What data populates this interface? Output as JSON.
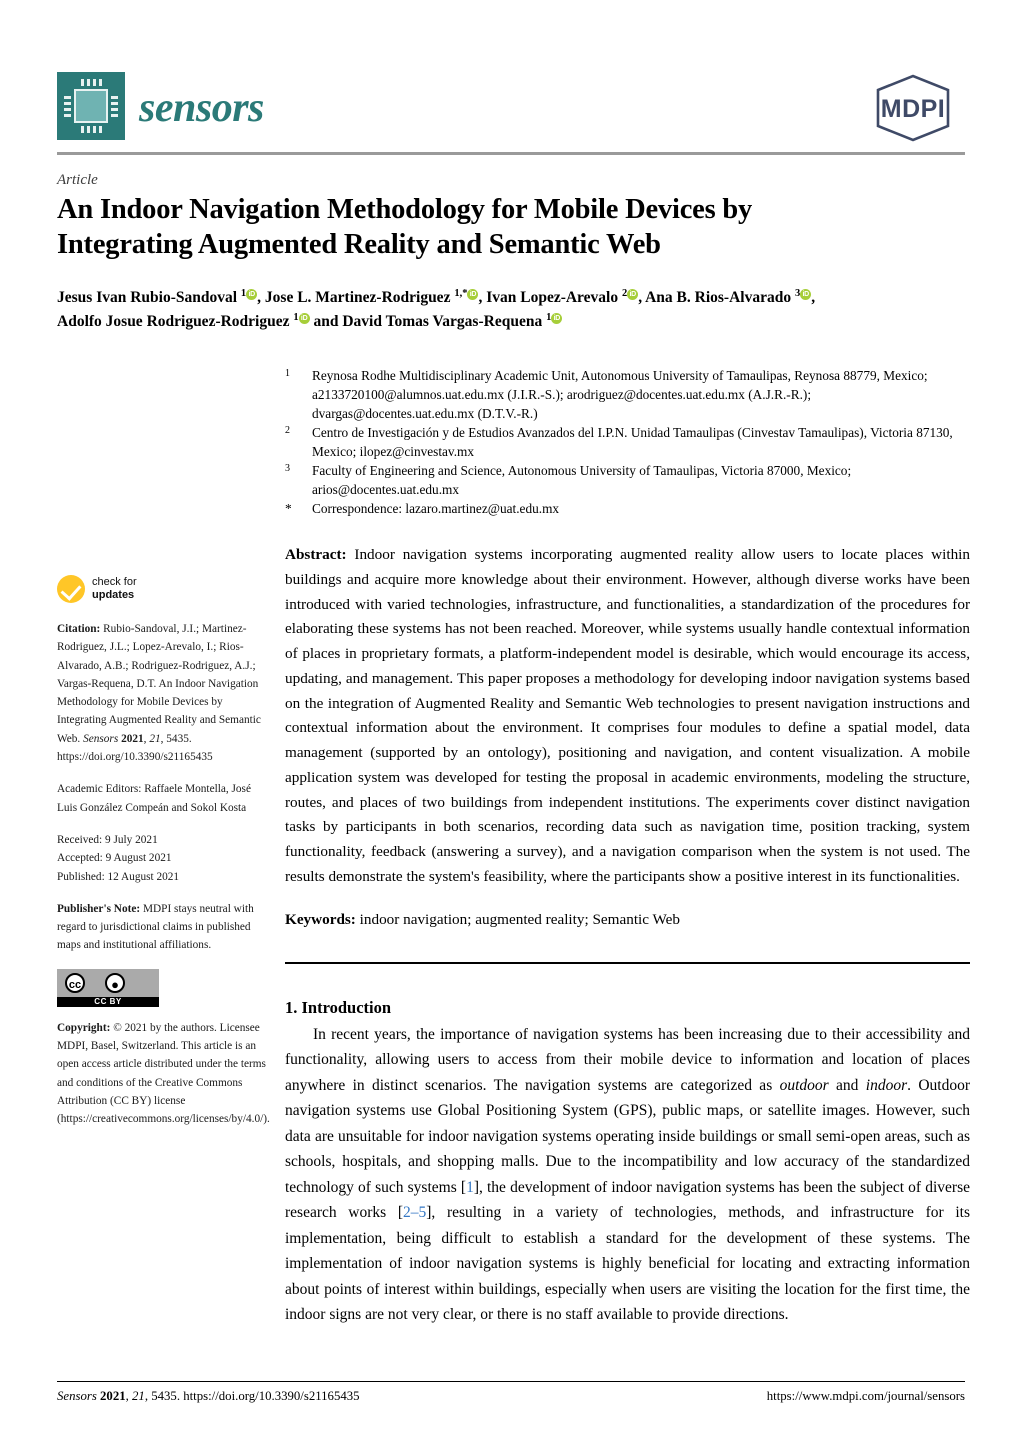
{
  "header": {
    "journal_name": "sensors",
    "publisher_logo": "MDPI",
    "logo_icon": "microchip-icon"
  },
  "article": {
    "kicker": "Article",
    "title_line1": "An Indoor Navigation Methodology for Mobile Devices by",
    "title_line2": "Integrating Augmented Reality and Semantic Web"
  },
  "authors": {
    "line1_html": "Jesus Ivan Rubio-Sandoval <sup class=\"sup\">1</sup><span class=\"orcid\">iD</span>, Jose L. Martinez-Rodriguez <sup class=\"sup\">1,*</sup><span class=\"orcid\">iD</span>, Ivan Lopez-Arevalo <sup class=\"sup\">2</sup><span class=\"orcid\">iD</span>, Ana B. Rios-Alvarado <sup class=\"sup\">3</sup><span class=\"orcid\">iD</span>,",
    "line2_html": "Adolfo Josue Rodriguez-Rodriguez <sup class=\"sup\">1</sup><span class=\"orcid\">iD</span> and David Tomas Vargas-Requena <sup class=\"sup\">1</sup><span class=\"orcid\">iD</span>",
    "plain": "Jesus Ivan Rubio-Sandoval 1, Jose L. Martinez-Rodriguez 1,*, Ivan Lopez-Arevalo 2, Ana B. Rios-Alvarado 3, Adolfo Josue Rodriguez-Rodriguez 1 and David Tomas Vargas-Requena 1"
  },
  "affiliations": [
    {
      "mark": "1",
      "text": "Reynosa Rodhe Multidisciplinary Academic Unit, Autonomous University of Tamaulipas, Reynosa 88779, Mexico; a2133720100@alumnos.uat.edu.mx (J.I.R.-S.); arodriguez@docentes.uat.edu.mx (A.J.R.-R.); dvargas@docentes.uat.edu.mx (D.T.V.-R.)"
    },
    {
      "mark": "2",
      "text": "Centro de Investigación y de Estudios Avanzados del I.P.N. Unidad Tamaulipas (Cinvestav Tamaulipas), Victoria 87130, Mexico; ilopez@cinvestav.mx"
    },
    {
      "mark": "3",
      "text": "Faculty of Engineering and Science, Autonomous University of Tamaulipas, Victoria 87000, Mexico; arios@docentes.uat.edu.mx"
    },
    {
      "mark": "*",
      "text": "Correspondence: lazaro.martinez@uat.edu.mx"
    }
  ],
  "abstract": {
    "label": "Abstract:",
    "text": "Indoor navigation systems incorporating augmented reality allow users to locate places within buildings and acquire more knowledge about their environment. However, although diverse works have been introduced with varied technologies, infrastructure, and functionalities, a standardization of the procedures for elaborating these systems has not been reached. Moreover, while systems usually handle contextual information of places in proprietary formats, a platform-independent model is desirable, which would encourage its access, updating, and management. This paper proposes a methodology for developing indoor navigation systems based on the integration of Augmented Reality and Semantic Web technologies to present navigation instructions and contextual information about the environment. It comprises four modules to define a spatial model, data management (supported by an ontology), positioning and navigation, and content visualization. A mobile application system was developed for testing the proposal in academic environments, modeling the structure, routes, and places of two buildings from independent institutions. The experiments cover distinct navigation tasks by participants in both scenarios, recording data such as navigation time, position tracking, system functionality, feedback (answering a survey), and a navigation comparison when the system is not used. The results demonstrate the system's feasibility, where the participants show a positive interest in its functionalities."
  },
  "keywords": {
    "label": "Keywords:",
    "text": "indoor navigation; augmented reality; Semantic Web"
  },
  "sidebar": {
    "check_updates_line1": "check for",
    "check_updates_line2": "updates",
    "citation_label": "Citation:",
    "citation_text": "Rubio-Sandoval, J.I.; Martinez-Rodriguez, J.L.; Lopez-Arevalo, I.; Rios-Alvarado, A.B.; Rodriguez-Rodriguez, A.J.; Vargas-Requena, D.T. An Indoor Navigation Methodology for Mobile Devices by Integrating Augmented Reality and Semantic Web.",
    "citation_journal": "Sensors",
    "citation_year": "2021",
    "citation_volume": "21",
    "citation_pages": "5435.",
    "citation_doi": "https://doi.org/10.3390/s21165435",
    "academic_editors": "Academic Editors: Raffaele Montella, José Luis González Compeán and Sokol Kosta",
    "received": "Received: 9 July 2021",
    "accepted": "Accepted: 9 August 2021",
    "published": "Published: 12 August 2021",
    "publisher_note_label": "Publisher's Note:",
    "publisher_note_text": "MDPI stays neutral with regard to jurisdictional claims in published maps and institutional affiliations.",
    "license_badge": "CC BY",
    "copyright_label": "Copyright:",
    "copyright_text": "© 2021 by the authors. Licensee MDPI, Basel, Switzerland. This article is an open access article distributed under the terms and conditions of the Creative Commons Attribution (CC BY) license (https://creativecommons.org/licenses/by/4.0/)."
  },
  "section": {
    "heading": "1. Introduction",
    "paragraph_html": "In recent years, the importance of navigation systems has been increasing due to their accessibility and functionality, allowing users to access from their mobile device to information and location of places anywhere in distinct scenarios. The navigation systems are categorized as <i>outdoor</i> and <i>indoor</i>. Outdoor navigation systems use Global Positioning System (GPS), public maps, or satellite images. However, such data are unsuitable for indoor navigation systems operating inside buildings or small semi-open areas, such as schools, hospitals, and shopping malls. Due to the incompatibility and low accuracy of the standardized technology of such systems [<span class=\"cite\">1</span>], the development of indoor navigation systems has been the subject of diverse research works [<span class=\"cite\">2&#8211;5</span>], resulting in a variety of technologies, methods, and infrastructure for its implementation, being difficult to establish a standard for the development of these systems. The implementation of indoor navigation systems is highly beneficial for locating and extracting information about points of interest within buildings, especially when users are visiting the location for the first time, the indoor signs are not very clear, or there is no staff available to provide directions.",
    "citations": [
      "1",
      "2–5"
    ]
  },
  "footer": {
    "left_html": "<i>Sensors</i> <b>2021</b>, <i>21</i>, 5435. https://doi.org/10.3390/s21165435",
    "right": "https://www.mdpi.com/journal/sensors"
  },
  "colors": {
    "journal_teal": "#2b7a78",
    "mdpi_navy": "#3f4a67",
    "orcid_green": "#a6ce39",
    "check_yellow": "#ffc627",
    "citation_blue": "#3477c4"
  }
}
